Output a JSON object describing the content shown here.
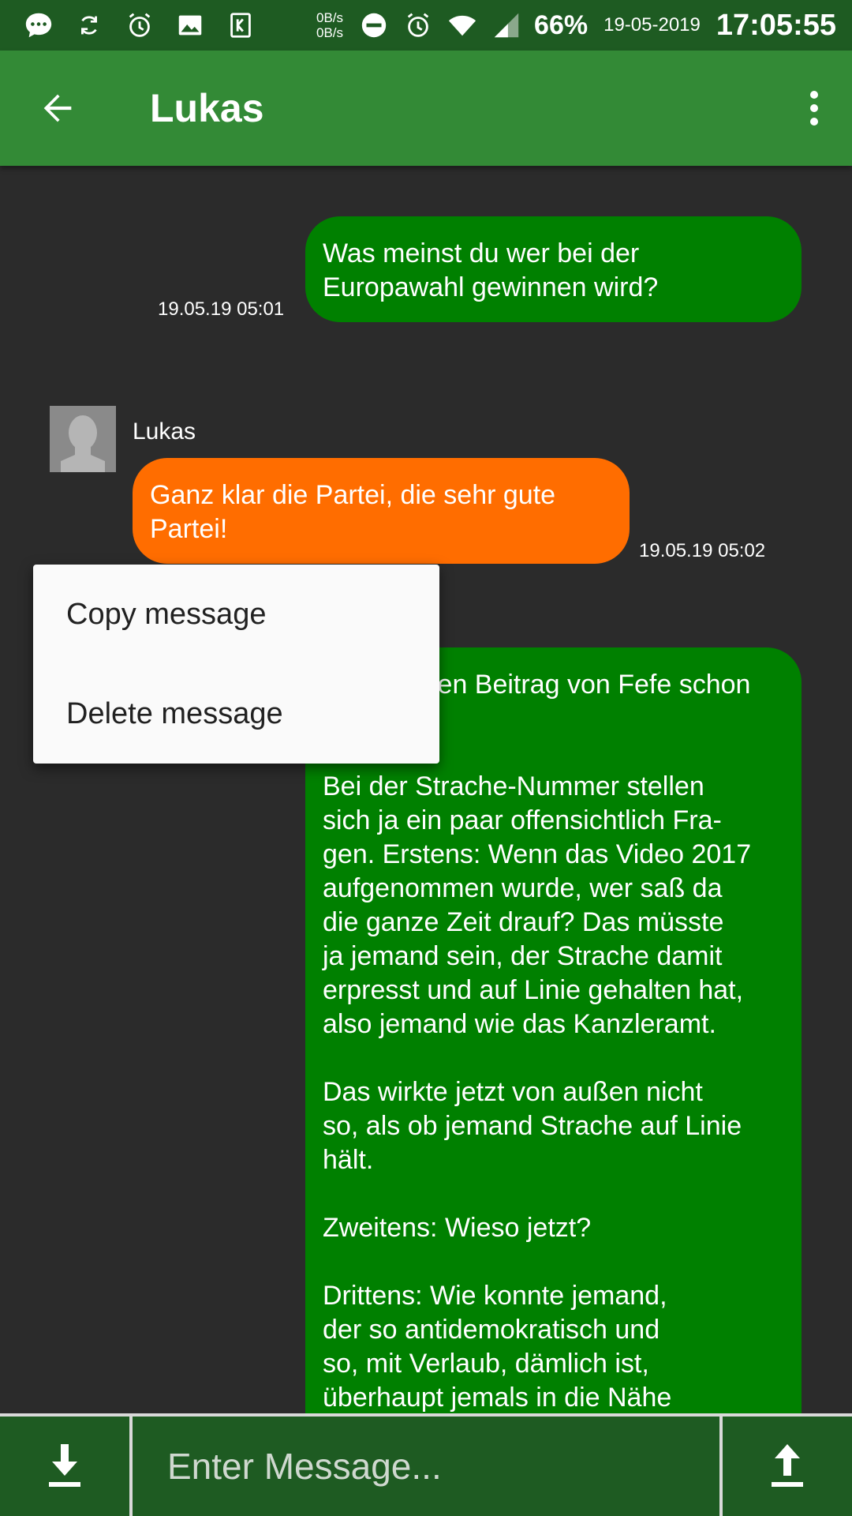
{
  "status_bar": {
    "net_up": "0B/s",
    "net_down": "0B/s",
    "battery": "66%",
    "date": "19-05-2019",
    "time": "17:05:55"
  },
  "app_bar": {
    "title": "Lukas",
    "back_icon": "arrow-back-icon",
    "menu_icon": "more-vert-icon"
  },
  "messages": [
    {
      "direction": "out",
      "text": "Was meinst du wer bei der\nEuropawahl gewinnen wird?",
      "time": "19.05.19 05:01"
    },
    {
      "direction": "in",
      "sender": "Lukas",
      "text": "Ganz klar die Partei, die sehr gute\nPartei!",
      "time": "19.05.19 05:02"
    },
    {
      "direction": "out",
      "text": "Hast du den Beitrag von Fefe schon\ngelesen?\n\nBei der Strache-Nummer stellen\nsich ja ein paar offensichtlich Fra-\ngen. Erstens: Wenn das Video 2017\naufgenommen wurde, wer saß da\ndie ganze Zeit drauf? Das müsste\nja jemand sein, der Strache damit\nerpresst und auf Linie gehalten hat,\nalso jemand wie das Kanzleramt.\n\nDas wirkte jetzt von außen nicht\nso, als ob jemand Strache auf Linie\nhält.\n\nZweitens: Wieso jetzt?\n\nDrittens: Wie konnte jemand,\nder so antidemokratisch und\nso, mit Verlaub, dämlich ist,\nüberhaupt jemals in die Nähe"
    }
  ],
  "context_menu": {
    "items": [
      "Copy message",
      "Delete message"
    ]
  },
  "composer": {
    "placeholder": "Enter Message...",
    "download_icon": "download-icon",
    "upload_icon": "upload-icon"
  },
  "colors": {
    "status_bar": "#1e5b22",
    "app_bar": "#338a36",
    "outgoing_bubble": "#008000",
    "incoming_bubble": "#ff6d00",
    "background": "#2b2b2b"
  }
}
